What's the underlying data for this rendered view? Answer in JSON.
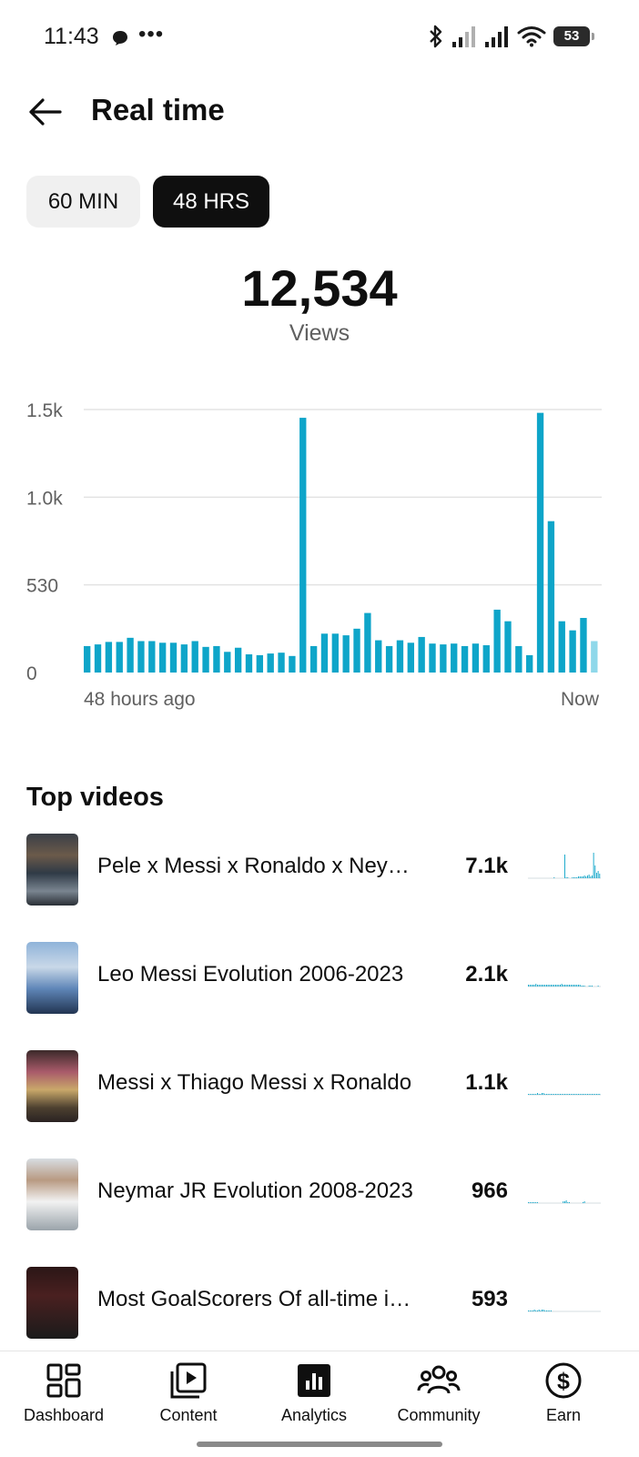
{
  "status_bar": {
    "time": "11:43",
    "dots": "•••",
    "battery": "53"
  },
  "header": {
    "title": "Real time",
    "back_icon": "arrow-left-icon"
  },
  "range_tabs": [
    {
      "label": "60 MIN",
      "selected": false
    },
    {
      "label": "48 HRS",
      "selected": true
    }
  ],
  "summary": {
    "total": "12,534",
    "label": "Views"
  },
  "chart_data": {
    "type": "bar",
    "color": "#0ea5c9",
    "x_start_label": "48 hours ago",
    "x_end_label": "Now",
    "y_ticks": [
      {
        "label": "0",
        "value": 0
      },
      {
        "label": "530",
        "value": 530
      },
      {
        "label": "1.0k",
        "value": 1060
      },
      {
        "label": "1.5k",
        "value": 1590
      }
    ],
    "ylim": [
      0,
      1590
    ],
    "grid": true,
    "values": [
      160,
      170,
      185,
      185,
      210,
      190,
      190,
      180,
      180,
      170,
      190,
      155,
      160,
      125,
      150,
      110,
      105,
      115,
      120,
      100,
      1540,
      160,
      235,
      235,
      225,
      265,
      360,
      195,
      160,
      195,
      180,
      215,
      175,
      170,
      175,
      160,
      175,
      165,
      380,
      310,
      160,
      105,
      1570,
      915,
      310,
      255,
      330,
      190
    ]
  },
  "top_videos": {
    "title": "Top videos",
    "items": [
      {
        "title": "Pele x Messi x Ronaldo x Neymar",
        "views": "7.1k",
        "spark": [
          0,
          0,
          0,
          0,
          0,
          0,
          0,
          0,
          0,
          0,
          0,
          0,
          0,
          0,
          0,
          0,
          0,
          1,
          0,
          0,
          0,
          0,
          0,
          0,
          26,
          1,
          1,
          0,
          0,
          1,
          1,
          1,
          1,
          2,
          2,
          2,
          2,
          3,
          2,
          3,
          4,
          2,
          3,
          28,
          14,
          6,
          8,
          5
        ]
      },
      {
        "title": "Leo Messi Evolution 2006-2023",
        "views": "2.1k",
        "spark": [
          2,
          2,
          2,
          2,
          2,
          3,
          2,
          2,
          2,
          2,
          2,
          2,
          2,
          2,
          2,
          2,
          2,
          2,
          2,
          2,
          2,
          2,
          3,
          2,
          2,
          2,
          2,
          2,
          2,
          2,
          2,
          2,
          2,
          2,
          2,
          1,
          1,
          1,
          0,
          0,
          1,
          1,
          1,
          0,
          0,
          0,
          1,
          0
        ]
      },
      {
        "title": "Messi x Thiago Messi x Ronaldo",
        "views": "1.1k",
        "spark": [
          1,
          1,
          1,
          1,
          1,
          1,
          2,
          1,
          1,
          2,
          2,
          1,
          1,
          1,
          1,
          1,
          1,
          1,
          1,
          1,
          1,
          1,
          1,
          1,
          1,
          1,
          1,
          1,
          1,
          1,
          1,
          1,
          1,
          1,
          1,
          1,
          1,
          1,
          1,
          1,
          1,
          1,
          1,
          1,
          1,
          1,
          1,
          1
        ]
      },
      {
        "title": "Neymar JR Evolution 2008-2023",
        "views": "966",
        "spark": [
          1,
          1,
          1,
          1,
          1,
          1,
          1,
          0,
          0,
          0,
          0,
          0,
          0,
          0,
          0,
          0,
          0,
          0,
          0,
          0,
          0,
          0,
          0,
          2,
          2,
          3,
          1,
          1,
          0,
          0,
          0,
          0,
          0,
          0,
          0,
          0,
          1,
          2,
          0,
          0,
          0,
          0,
          0,
          0,
          0,
          0,
          0,
          0
        ]
      },
      {
        "title": "Most GoalScorers Of all-time in Football",
        "views": "593",
        "spark": [
          1,
          1,
          1,
          1,
          2,
          1,
          1,
          2,
          1,
          2,
          2,
          1,
          1,
          1,
          1,
          1,
          0,
          0,
          0,
          0,
          0,
          0,
          0,
          0,
          0,
          0,
          0,
          0,
          0,
          0,
          0,
          0,
          0,
          0,
          0,
          0,
          0,
          0,
          0,
          0,
          0,
          0,
          0,
          0,
          0,
          0,
          0,
          0
        ]
      }
    ]
  },
  "bottom_nav": [
    {
      "label": "Dashboard",
      "icon": "dashboard-grid-icon",
      "active": false
    },
    {
      "label": "Content",
      "icon": "content-play-icon",
      "active": false
    },
    {
      "label": "Analytics",
      "icon": "analytics-bar-icon",
      "active": true
    },
    {
      "label": "Community",
      "icon": "community-people-icon",
      "active": false
    },
    {
      "label": "Earn",
      "icon": "earn-dollar-icon",
      "active": false
    }
  ]
}
